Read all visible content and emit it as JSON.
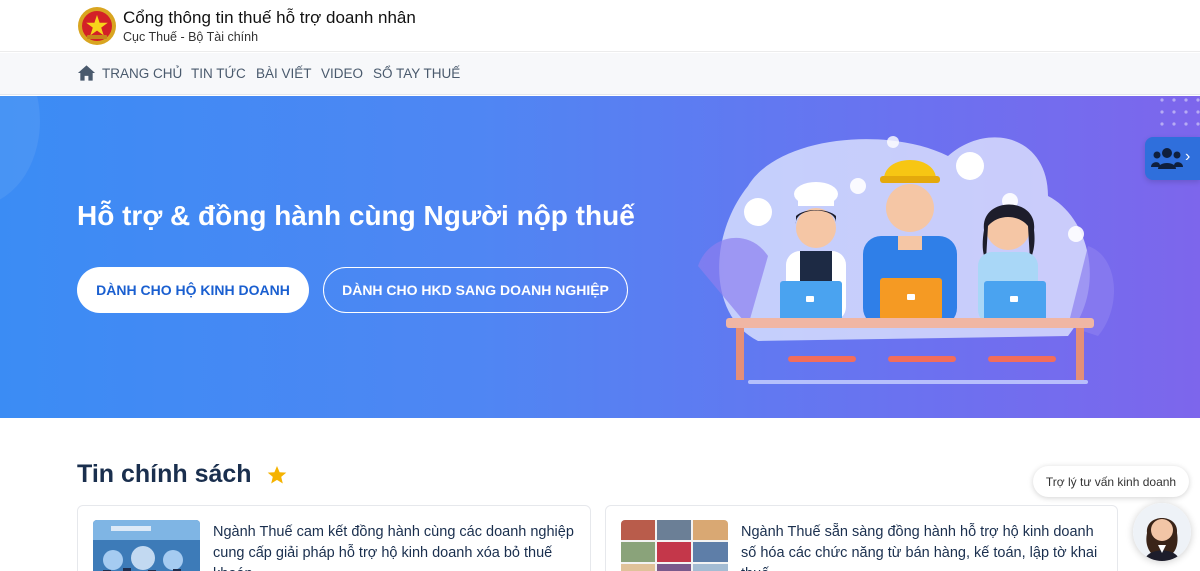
{
  "header": {
    "title": "Cổng thông tin thuế hỗ trợ doanh nhân",
    "subtitle": "Cục Thuế - Bộ Tài chính",
    "logo_icon": "national-emblem-icon"
  },
  "nav": {
    "home_icon": "home-icon",
    "items": [
      {
        "label": "TRANG CHỦ"
      },
      {
        "label": "TIN TỨC"
      },
      {
        "label": "BÀI VIẾT"
      },
      {
        "label": "VIDEO"
      },
      {
        "label": "SỔ TAY THUẾ"
      }
    ]
  },
  "hero": {
    "title": "Hỗ trợ & đồng hành cùng Người nộp thuế",
    "primary_button": "DÀNH CHO HỘ KINH DOANH",
    "secondary_button": "DÀNH CHO HKD SANG DOANH NGHIỆP",
    "colors": {
      "gradient_start": "#3b8cf4",
      "gradient_end": "#7d66ec"
    }
  },
  "side_tab": {
    "icon": "users-icon",
    "chevron": "›"
  },
  "section": {
    "title": "Tin chính sách",
    "icon": "star-icon",
    "accent": "#f5b301"
  },
  "cards": [
    {
      "text": "Ngành Thuế cam kết đồng hành cùng các doanh nghiệp cung cấp giải pháp hỗ trợ hộ kinh doanh xóa bỏ thuế khoán"
    },
    {
      "text": "Ngành Thuế sẵn sàng đồng hành hỗ trợ hộ kinh doanh số hóa các chức năng từ bán hàng, kế toán, lập tờ khai thuế"
    }
  ],
  "assistant": {
    "label": "Trợ lý tư vấn kinh doanh",
    "avatar_icon": "assistant-avatar-icon"
  }
}
